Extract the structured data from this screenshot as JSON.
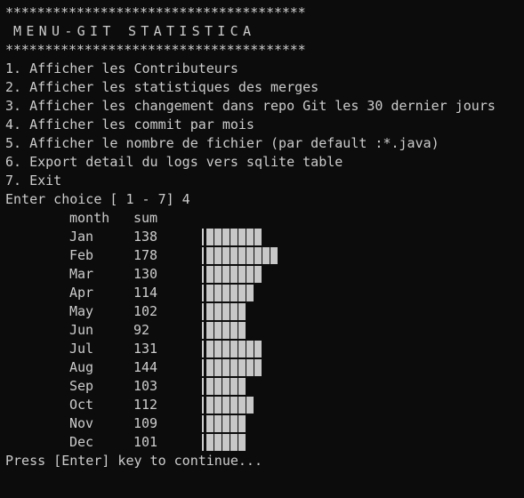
{
  "terminal": {
    "border": "**************************************",
    "title": "MENU-GIT STATISTICA",
    "menu": [
      "1. Afficher les Contributeurs",
      "2. Afficher les statistiques des merges",
      "3. Afficher les changement dans repo Git les 30 dernier jours",
      "4. Afficher les commit par mois",
      "5. Afficher le nombre de fichier (par default :*.java)",
      "6. Export detail du logs vers sqlite table",
      "7. Exit"
    ],
    "prompt": "Enter choice [ 1 - 7] 4",
    "table": {
      "col_month": "month",
      "col_sum": "sum",
      "rows": [
        {
          "month": "Jan",
          "sum": "138",
          "blocks": 7
        },
        {
          "month": "Feb",
          "sum": "178",
          "blocks": 9
        },
        {
          "month": "Mar",
          "sum": "130",
          "blocks": 7
        },
        {
          "month": "Apr",
          "sum": "114",
          "blocks": 6
        },
        {
          "month": "May",
          "sum": "102",
          "blocks": 5
        },
        {
          "month": "Jun",
          "sum": "92",
          "blocks": 5
        },
        {
          "month": "Jul",
          "sum": "131",
          "blocks": 7
        },
        {
          "month": "Aug",
          "sum": "144",
          "blocks": 7
        },
        {
          "month": "Sep",
          "sum": "103",
          "blocks": 5
        },
        {
          "month": "Oct",
          "sum": "112",
          "blocks": 6
        },
        {
          "month": "Nov",
          "sum": "109",
          "blocks": 5
        },
        {
          "month": "Dec",
          "sum": "101",
          "blocks": 5
        }
      ]
    },
    "footer": "Press [Enter] key to continue..."
  },
  "colors": {
    "background": "#0c0c0c",
    "text": "#cccccc",
    "bar": "#c8c8c8"
  }
}
